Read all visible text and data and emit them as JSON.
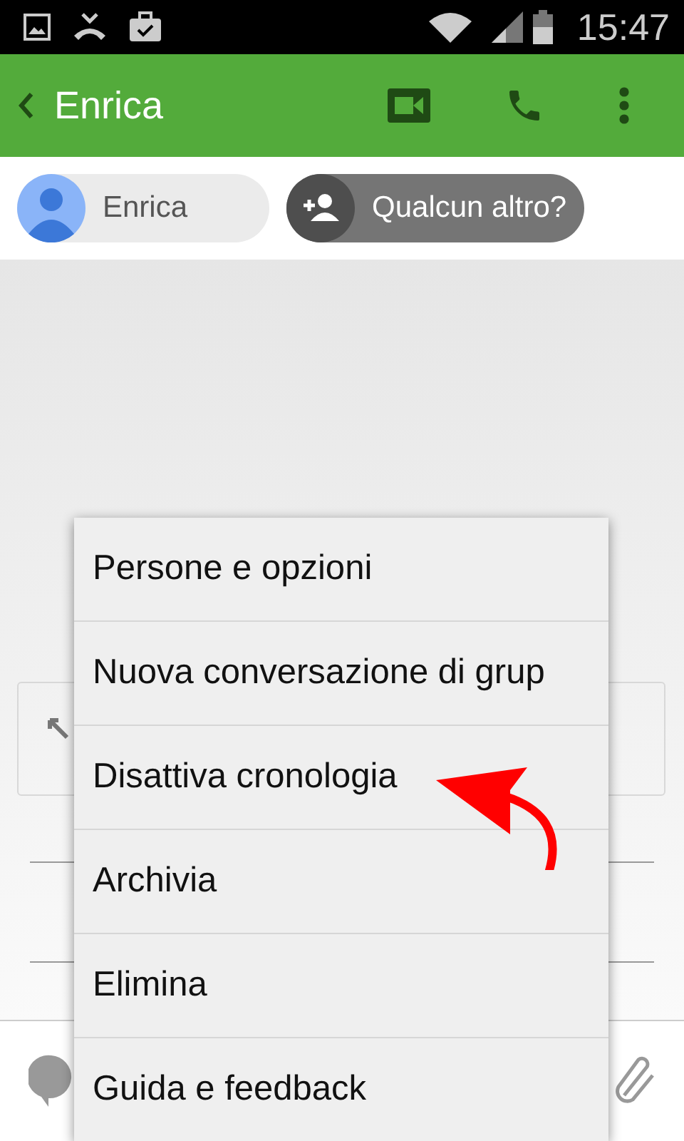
{
  "status_bar": {
    "time": "15:47"
  },
  "app_bar": {
    "title": "Enrica"
  },
  "participants": [
    {
      "kind": "contact",
      "label": "Enrica"
    },
    {
      "kind": "add",
      "label": "Qualcun altro?"
    }
  ],
  "menu": {
    "items": [
      {
        "label": "Persone e opzioni"
      },
      {
        "label": "Nuova conversazione di grup"
      },
      {
        "label": "Disattiva cronologia"
      },
      {
        "label": "Archivia"
      },
      {
        "label": "Elimina"
      },
      {
        "label": "Guida e feedback"
      }
    ]
  }
}
